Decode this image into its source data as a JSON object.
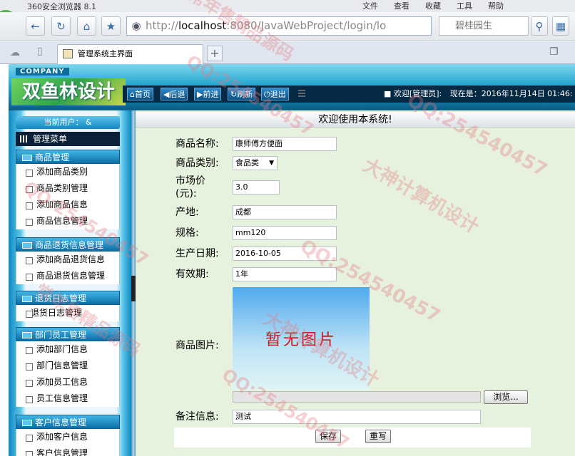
{
  "browser": {
    "title": "360安全浏览器 8.1",
    "menus": [
      "文件",
      "查看",
      "收藏",
      "工具",
      "帮助"
    ],
    "url_prefix": "http://",
    "url_host": "localhost",
    "url_rest": ":8080/JavaWebProject/login/lo",
    "search_text": "碧桂园生",
    "tab_title": "管理系统主界面"
  },
  "header": {
    "company": "COMPANY",
    "brand": "双鱼林设计",
    "nav": [
      "首页",
      "后退",
      "前进",
      "刷新",
      "退出"
    ],
    "welcome": "欢迎[管理员]:",
    "now_label": "现在是：2016年11月14日 01:46:"
  },
  "sidebar": {
    "current_user": "当前用户： &",
    "menu_title": "管理菜单",
    "groups": [
      {
        "title": "商品管理",
        "items": [
          "添加商品类别",
          "商品类别管理",
          "添加商品信息",
          "商品信息管理"
        ]
      },
      {
        "title": "商品退货信息管理",
        "items": [
          "添加商品退货信息",
          "商品退货信息管理"
        ]
      },
      {
        "title": "退货日志管理",
        "items": [
          "退货日志管理"
        ]
      },
      {
        "title": "部门员工管理",
        "items": [
          "添加部门信息",
          "部门信息管理",
          "添加员工信息",
          "员工信息管理"
        ]
      },
      {
        "title": "客户信息管理",
        "items": [
          "添加客户信息",
          "客户信息管理"
        ]
      }
    ]
  },
  "content": {
    "title": "欢迎使用本系统!",
    "form": {
      "name_label": "商品名称:",
      "name_value": "康师傅方便面",
      "type_label": "商品类别:",
      "type_value": "食品类",
      "price_label_1": "市场价",
      "price_label_2": "(元):",
      "price_value": "3.0",
      "origin_label": "产地:",
      "origin_value": "成都",
      "spec_label": "规格:",
      "spec_value": "mm120",
      "date_label": "生产日期:",
      "date_value": "2016-10-05",
      "expiry_label": "有效期:",
      "expiry_value": "1年",
      "picture_label": "商品图片:",
      "picture_placeholder": "暂无图片",
      "browse_label": "浏览...",
      "memo_label": "备注信息:",
      "memo_value": "测试",
      "save_label": "保存",
      "reset_label": "重写"
    }
  },
  "watermarks": [
    "QQ:254540457",
    "大神计算机设计",
    "常年售精品源码"
  ]
}
